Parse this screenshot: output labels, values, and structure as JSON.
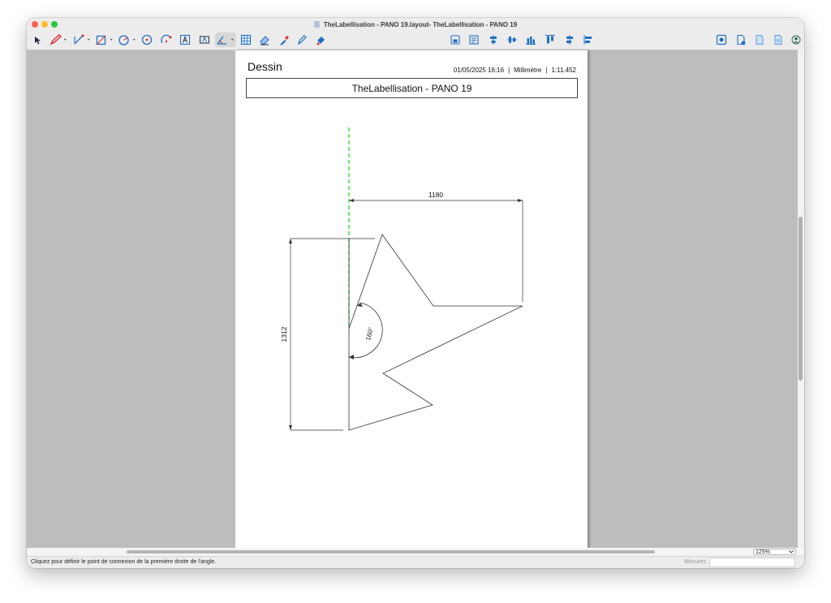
{
  "window": {
    "title": "TheLabellisation - PANO 19.layout- TheLabellisation - PANO 19"
  },
  "toolbar": {
    "left_tools": [
      {
        "icon": "arrow-cursor-icon",
        "has_menu": false
      },
      {
        "icon": "pencil-icon",
        "has_menu": true
      },
      {
        "icon": "line-segment-icon",
        "has_menu": true
      },
      {
        "icon": "rectangle-icon",
        "has_menu": true
      },
      {
        "icon": "circle-icon",
        "has_menu": true
      },
      {
        "icon": "circle-center-icon",
        "has_menu": false
      },
      {
        "icon": "arc-icon",
        "has_menu": false
      },
      {
        "icon": "text-box-icon",
        "has_menu": false
      },
      {
        "icon": "text-field-icon",
        "has_menu": false
      },
      {
        "icon": "angle-dimension-icon",
        "has_menu": true,
        "active": true
      },
      {
        "icon": "table-grid-icon",
        "has_menu": false
      },
      {
        "icon": "eraser-icon",
        "has_menu": false
      },
      {
        "icon": "eyedropper-icon",
        "has_menu": false
      },
      {
        "icon": "pen-nib-icon",
        "has_menu": false
      },
      {
        "icon": "fill-bucket-icon",
        "has_menu": false
      }
    ],
    "center_tools": [
      {
        "icon": "save-layout-icon"
      },
      {
        "icon": "layout-page-icon"
      },
      {
        "icon": "align-center-vertical-icon"
      },
      {
        "icon": "align-middle-icon"
      },
      {
        "icon": "distribute-bottom-icon"
      },
      {
        "icon": "align-top-icon"
      },
      {
        "icon": "align-left-icon"
      },
      {
        "icon": "align-right-icon"
      }
    ],
    "right_tools": [
      {
        "icon": "preview-icon"
      },
      {
        "icon": "new-page-icon"
      },
      {
        "icon": "document-icon"
      },
      {
        "icon": "document-lines-icon"
      },
      {
        "icon": "user-account-icon"
      }
    ]
  },
  "page": {
    "heading": "Dessin",
    "date": "01/05/2025 16:16",
    "unit": "Millimètre",
    "scale": "1:11.452",
    "separator": "|",
    "title_box": "TheLabellisation - PANO 19",
    "dimensions": {
      "horizontal": "1180",
      "vertical": "1312",
      "angle": "160°"
    },
    "colors": {
      "guide_line": "#22dd22",
      "drawing_line": "#333333"
    }
  },
  "zoom": {
    "value": "125%"
  },
  "statusbar": {
    "hint": "Cliquez pour définir le point de connexion de la première droite de l'angle.",
    "measures_label": "Mesures",
    "measures_value": ""
  }
}
